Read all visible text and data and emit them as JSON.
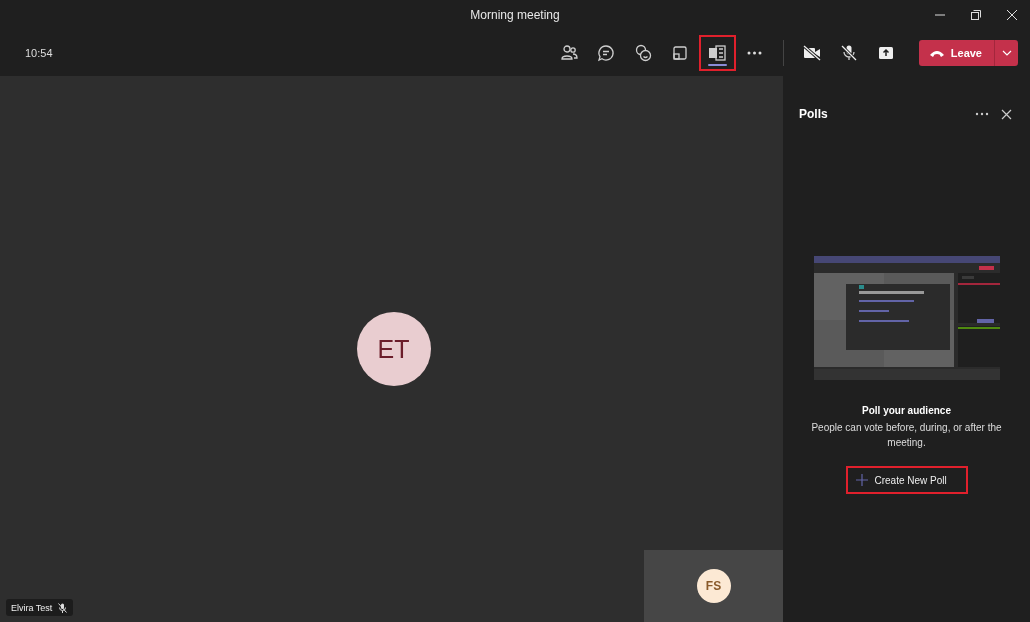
{
  "window": {
    "title": "Morning meeting"
  },
  "toolbar": {
    "time": "10:54",
    "buttons": [
      {
        "kind": "people",
        "selected": false,
        "highlighted": false
      },
      {
        "kind": "chat",
        "selected": false,
        "highlighted": false
      },
      {
        "kind": "reactions",
        "selected": false,
        "highlighted": false
      },
      {
        "kind": "layout",
        "selected": false,
        "highlighted": false
      },
      {
        "kind": "apps",
        "selected": true,
        "highlighted": true
      },
      {
        "kind": "more",
        "selected": false,
        "highlighted": false
      }
    ],
    "controls": [
      {
        "kind": "camera-off"
      },
      {
        "kind": "mic-off"
      },
      {
        "kind": "share"
      }
    ],
    "leave": {
      "label": "Leave"
    }
  },
  "stage": {
    "main_avatar": {
      "initials": "ET"
    },
    "self_view": {
      "initials": "FS"
    },
    "name_tag": {
      "name": "Elvira Test",
      "muted": true
    }
  },
  "panel": {
    "title": "Polls",
    "empty_state": {
      "heading": "Poll your audience",
      "text": "People can vote before, during, or after the meeting.",
      "button": {
        "label": "Create New Poll",
        "highlighted": true
      }
    }
  }
}
